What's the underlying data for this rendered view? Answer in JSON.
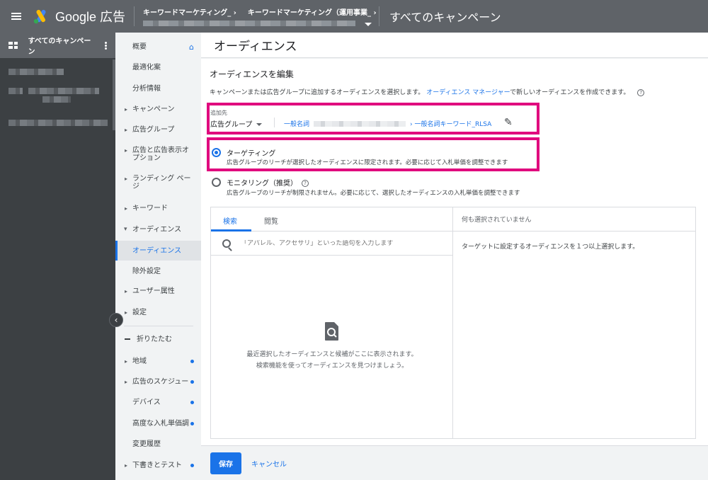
{
  "header": {
    "logo_text": "Google 広告",
    "breadcrumbs": [
      "キーワードマーケティング_",
      "キーワードマーケティング（運用事業_"
    ],
    "title": "すべてのキャンペーン"
  },
  "darkside": {
    "title": "すべてのキャンペーン"
  },
  "nav": {
    "items": [
      "概要",
      "最適化案",
      "分析情報",
      "キャンペーン",
      "広告グループ",
      "広告と広告表示オプション",
      "ランディング ページ",
      "キーワード",
      "オーディエンス",
      "オーディエンス",
      "除外設定",
      "ユーザー属性",
      "設定",
      "折りたたむ",
      "地域",
      "広告のスケジュー",
      "デバイス",
      "高度な入札単価調",
      "変更履歴",
      "下書きとテスト"
    ]
  },
  "main": {
    "page_title": "オーディエンス",
    "section_title": "オーディエンスを編集",
    "desc_before": "キャンペーンまたは広告グループに追加するオーディエンスを選択します。",
    "desc_link": "オーディエンス マネージャー",
    "desc_after": "で新しいオーディエンスを作成できます。",
    "help": "?",
    "addto_label": "追加先",
    "addto_value": "広告グループ",
    "path_start": "一般名詞",
    "path_end": "› 一般名詞キーワード_RLSA",
    "targeting_title": "ターゲティング",
    "targeting_desc": "広告グループのリーチが選択したオーディエンスに限定されます。必要に応じて入札単価を調整できます",
    "monitoring_title": "モニタリング（推奨）",
    "monitoring_desc": "広告グループのリーチが制限されません。必要に応じて、選択したオーディエンスの入札単価を調整できます",
    "tab_search": "検索",
    "tab_browse": "閲覧",
    "search_placeholder": "「アパレル、アクセサリ」といった語句を入力します",
    "empty_line1": "最近選択したオーディエンスと候補がここに表示されます。",
    "empty_line2": "検索機能を使ってオーディエンスを見つけましょう。",
    "right_header": "何も選択されていません",
    "right_text": "ターゲットに設定するオーディエンスを１つ以上選択します。",
    "save": "保存",
    "cancel": "キャンセル"
  },
  "colors": {
    "accent": "#1a73e8",
    "highlight": "#e0097e",
    "topbar": "#5f6368"
  }
}
